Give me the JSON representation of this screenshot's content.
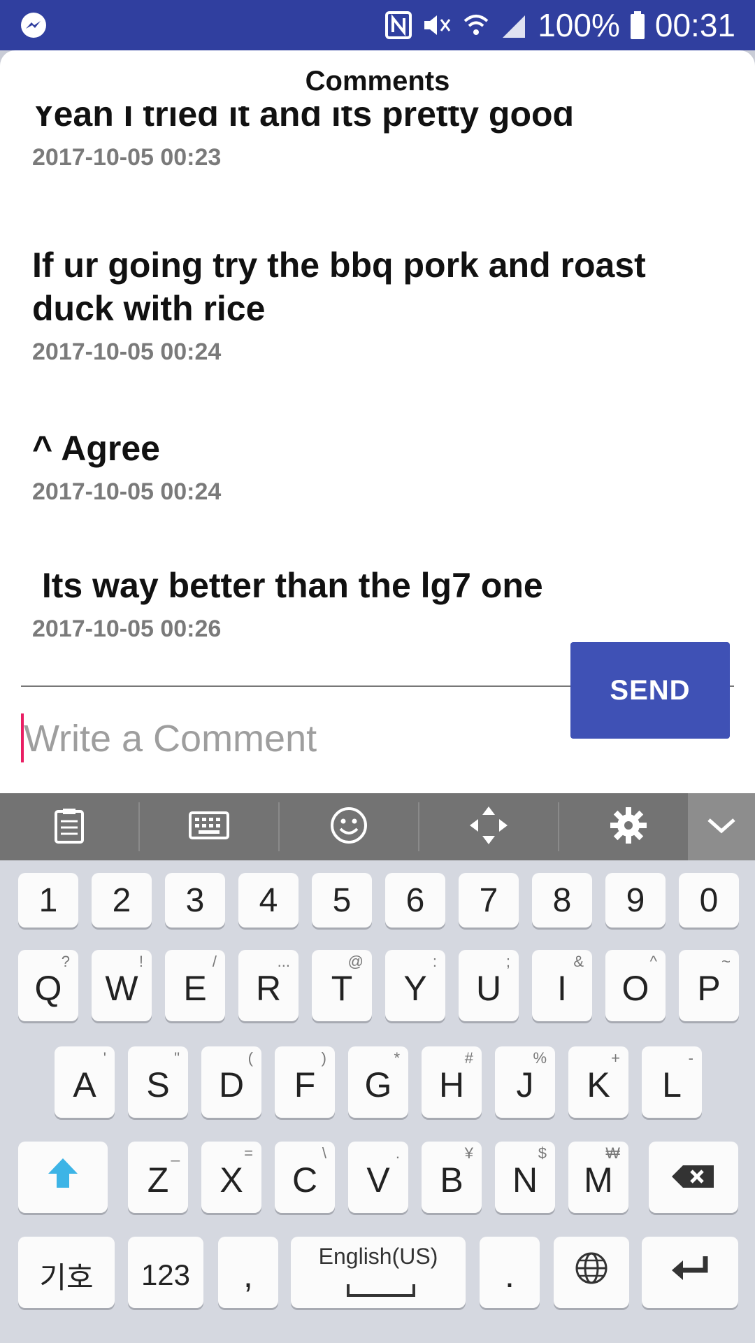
{
  "status_bar": {
    "app_icon": "messenger-icon",
    "icons": [
      "nfc-icon",
      "vibrate-icon",
      "wifi-icon",
      "signal-icon"
    ],
    "battery": "100%",
    "time": "00:31",
    "colors": {
      "background": "#303f9f"
    }
  },
  "header": {
    "title": "Comments"
  },
  "comments": [
    {
      "text": "Yeah I tried it and its pretty good",
      "time": "2017-10-05 00:23"
    },
    {
      "text": "If ur going try the bbq pork and roast duck with rice",
      "time": "2017-10-05 00:24"
    },
    {
      "text": "^ Agree",
      "time": "2017-10-05 00:24"
    },
    {
      "text": " Its way better than the lg7 one",
      "time": "2017-10-05 00:26"
    }
  ],
  "composer": {
    "placeholder": "Write a Comment",
    "send_label": "SEND",
    "colors": {
      "send": "#3f51b5",
      "caret": "#e91e63"
    }
  },
  "keyboard_toolbar": {
    "icons": [
      "clipboard-icon",
      "keyboard-icon",
      "emoji-icon",
      "move-icon",
      "settings-icon",
      "collapse-icon"
    ]
  },
  "keyboard": {
    "number_row": [
      "1",
      "2",
      "3",
      "4",
      "5",
      "6",
      "7",
      "8",
      "9",
      "0"
    ],
    "row1": [
      {
        "key": "Q",
        "alt": "?"
      },
      {
        "key": "W",
        "alt": "!"
      },
      {
        "key": "E",
        "alt": "/"
      },
      {
        "key": "R",
        "alt": "..."
      },
      {
        "key": "T",
        "alt": "@"
      },
      {
        "key": "Y",
        "alt": ":"
      },
      {
        "key": "U",
        "alt": ";"
      },
      {
        "key": "I",
        "alt": "&"
      },
      {
        "key": "O",
        "alt": "^"
      },
      {
        "key": "P",
        "alt": "~"
      }
    ],
    "row2": [
      {
        "key": "A",
        "alt": "'"
      },
      {
        "key": "S",
        "alt": "\""
      },
      {
        "key": "D",
        "alt": "("
      },
      {
        "key": "F",
        "alt": ")"
      },
      {
        "key": "G",
        "alt": "*"
      },
      {
        "key": "H",
        "alt": "#"
      },
      {
        "key": "J",
        "alt": "%"
      },
      {
        "key": "K",
        "alt": "+"
      },
      {
        "key": "L",
        "alt": "-"
      }
    ],
    "row3": [
      {
        "key": "Z",
        "alt": "_"
      },
      {
        "key": "X",
        "alt": "="
      },
      {
        "key": "C",
        "alt": "\\"
      },
      {
        "key": "V",
        "alt": "."
      },
      {
        "key": "B",
        "alt": "¥"
      },
      {
        "key": "N",
        "alt": "$"
      },
      {
        "key": "M",
        "alt": "₩"
      }
    ],
    "bottom": {
      "symbols": "기호",
      "numbers": "123",
      "comma": ",",
      "space": "English(US)",
      "period": "."
    }
  }
}
